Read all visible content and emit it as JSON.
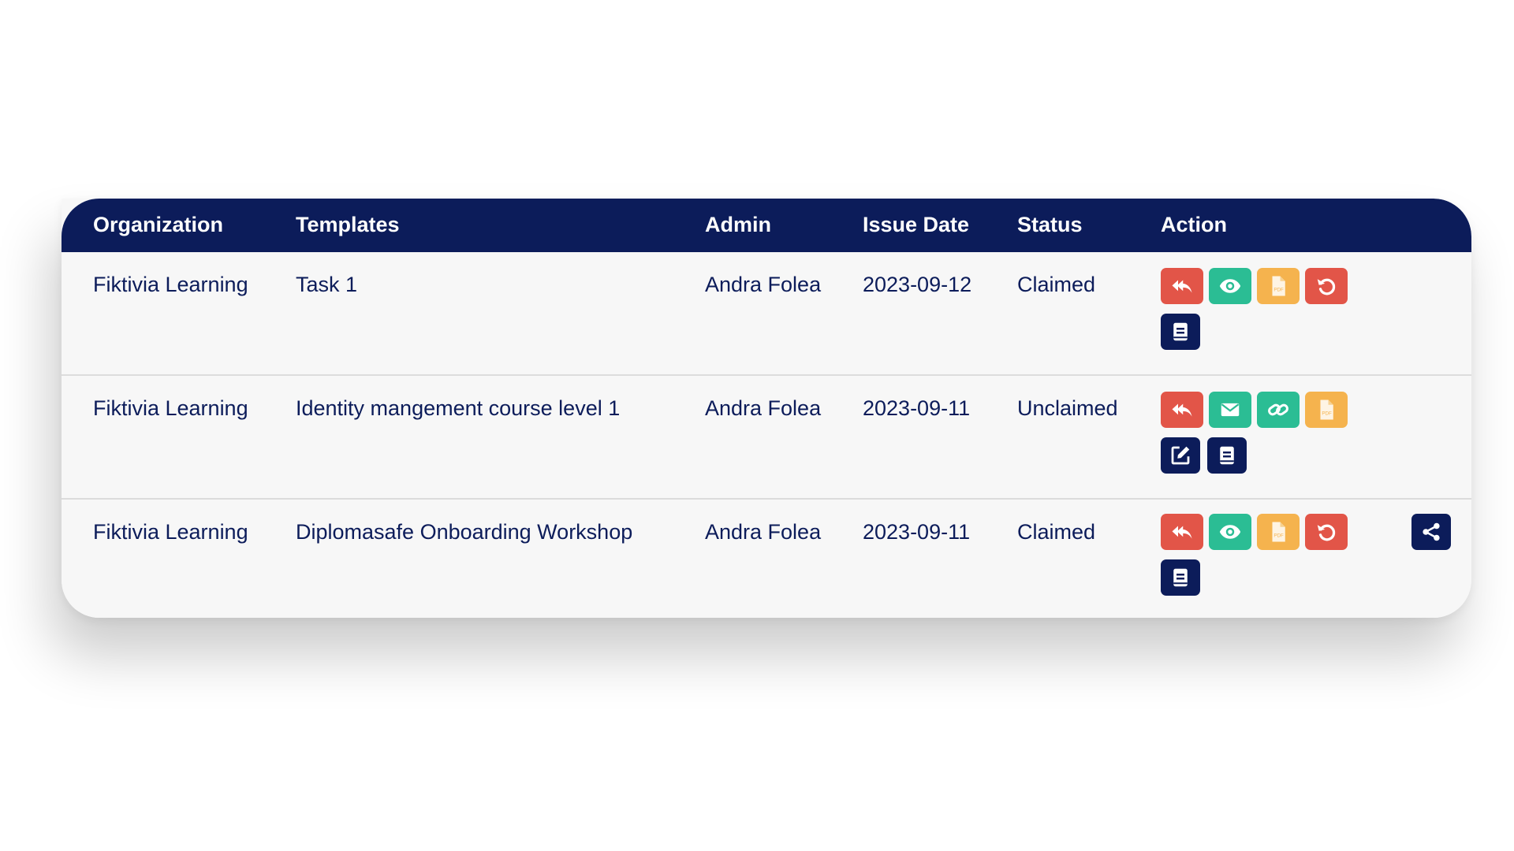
{
  "table": {
    "columns": [
      "Organization",
      "Templates",
      "Admin",
      "Issue Date",
      "Status",
      "Action"
    ],
    "rows": [
      {
        "organization": "Fiktivia Learning",
        "template": "Task 1",
        "admin": "Andra Folea",
        "issue_date": "2023-09-12",
        "status": "Claimed",
        "actions": [
          "reply-all-icon",
          "eye-icon",
          "pdf-file-icon",
          "undo-icon",
          "book-icon"
        ]
      },
      {
        "organization": "Fiktivia Learning",
        "template": "Identity mangement course level 1",
        "admin": "Andra Folea",
        "issue_date": "2023-09-11",
        "status": "Unclaimed",
        "actions": [
          "reply-all-icon",
          "envelope-icon",
          "link-icon",
          "pdf-file-icon",
          "edit-icon",
          "book-icon"
        ]
      },
      {
        "organization": "Fiktivia Learning",
        "template": "Diplomasafe Onboarding Workshop",
        "admin": "Andra Folea",
        "issue_date": "2023-09-11",
        "status": "Claimed",
        "actions": [
          "reply-all-icon",
          "eye-icon",
          "pdf-file-icon",
          "undo-icon",
          "book-icon",
          "share-icon"
        ]
      }
    ]
  },
  "icon_text": {
    "pdf": "PDF"
  },
  "colors": {
    "header_bg": "#0c1c5a",
    "text": "#0c1c5a",
    "red": "#e25548",
    "green": "#2bbd94",
    "orange": "#f5b34e",
    "navy": "#0c1c5a"
  }
}
